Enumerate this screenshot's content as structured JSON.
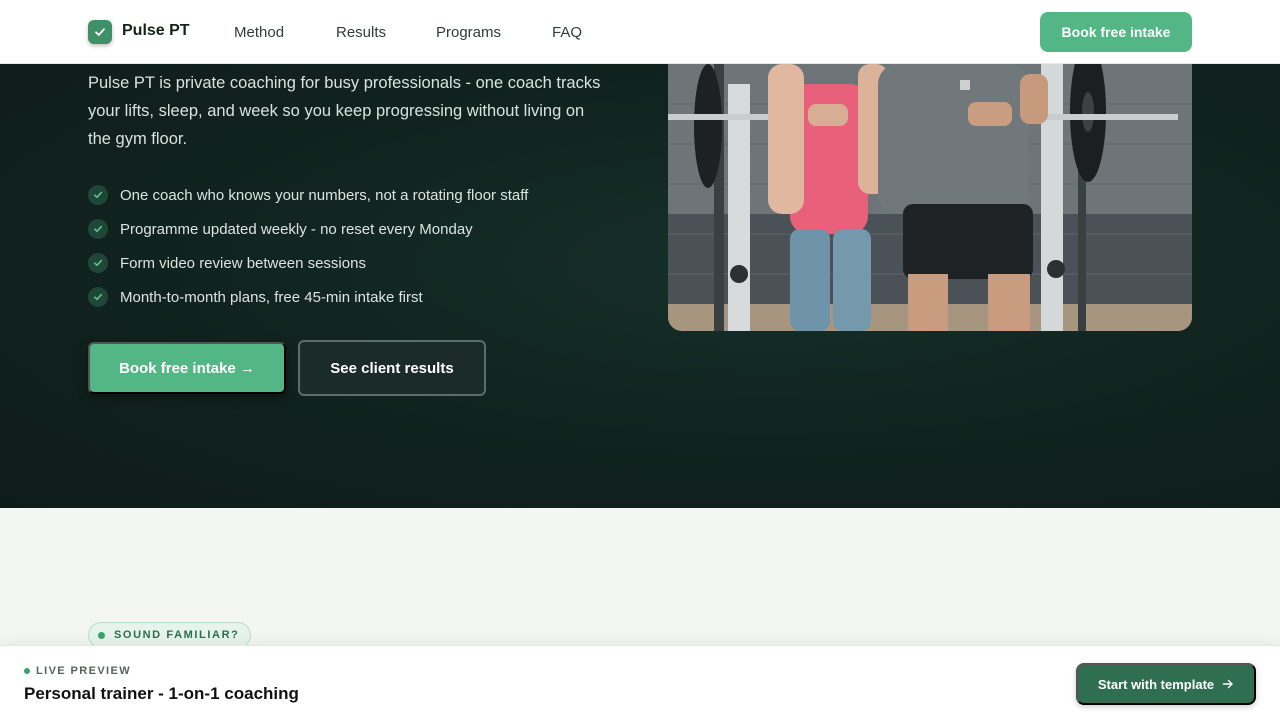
{
  "header": {
    "brand": "Pulse PT",
    "logo_icon": "check-icon",
    "nav": [
      "Method",
      "Results",
      "Programs",
      "FAQ"
    ],
    "cta": "Book free intake"
  },
  "hero": {
    "description": "Pulse PT is private coaching for busy professionals - one coach tracks your lifts, sleep, and week so you keep progressing without living on the gym floor.",
    "benefits": [
      "One coach who knows your numbers, not a rotating floor staff",
      "Programme updated weekly - no reset every Monday",
      "Form video review between sessions",
      "Month-to-month plans, free 45-min intake first"
    ],
    "primary_cta": "Book free intake →",
    "secondary_cta": "See client results"
  },
  "section": {
    "badge": "SOUND FAMILIAR?"
  },
  "preview_bar": {
    "live_label": "LIVE PREVIEW",
    "title": "Personal trainer - 1-on-1 coaching",
    "button": "Start with template"
  },
  "colors": {
    "accent": "#52b685",
    "accent_dark": "#2f6e51",
    "hero_bg": "#112420"
  }
}
